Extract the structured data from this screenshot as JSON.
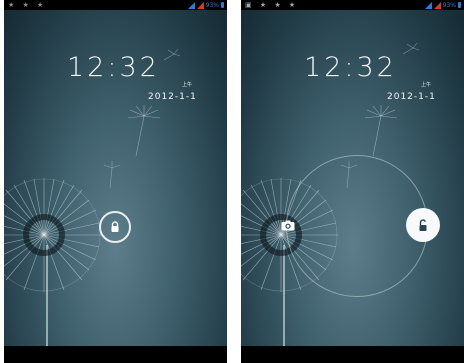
{
  "screens": [
    {
      "status_bar": {
        "left_icons": "★ ★ ★",
        "battery_text": "93%",
        "signal_icon": "signal-icon",
        "battery_icon": "battery-icon"
      },
      "clock": {
        "time": "12:32",
        "ampm": "上午",
        "date": "2012-1-1"
      },
      "lock_icon": "lock-icon"
    },
    {
      "status_bar": {
        "left_icons": "▣ ★ ★ ★",
        "battery_text": "93%",
        "signal_icon": "signal-icon",
        "battery_icon": "battery-icon"
      },
      "clock": {
        "time": "12:32",
        "ampm": "上午",
        "date": "2012-1-1"
      },
      "camera_icon": "camera-icon",
      "unlock_icon": "unlock-icon"
    }
  ],
  "colors": {
    "accent": "#2e7bd6",
    "signal_red": "#d43a2a",
    "text": "#f4f7f9"
  }
}
